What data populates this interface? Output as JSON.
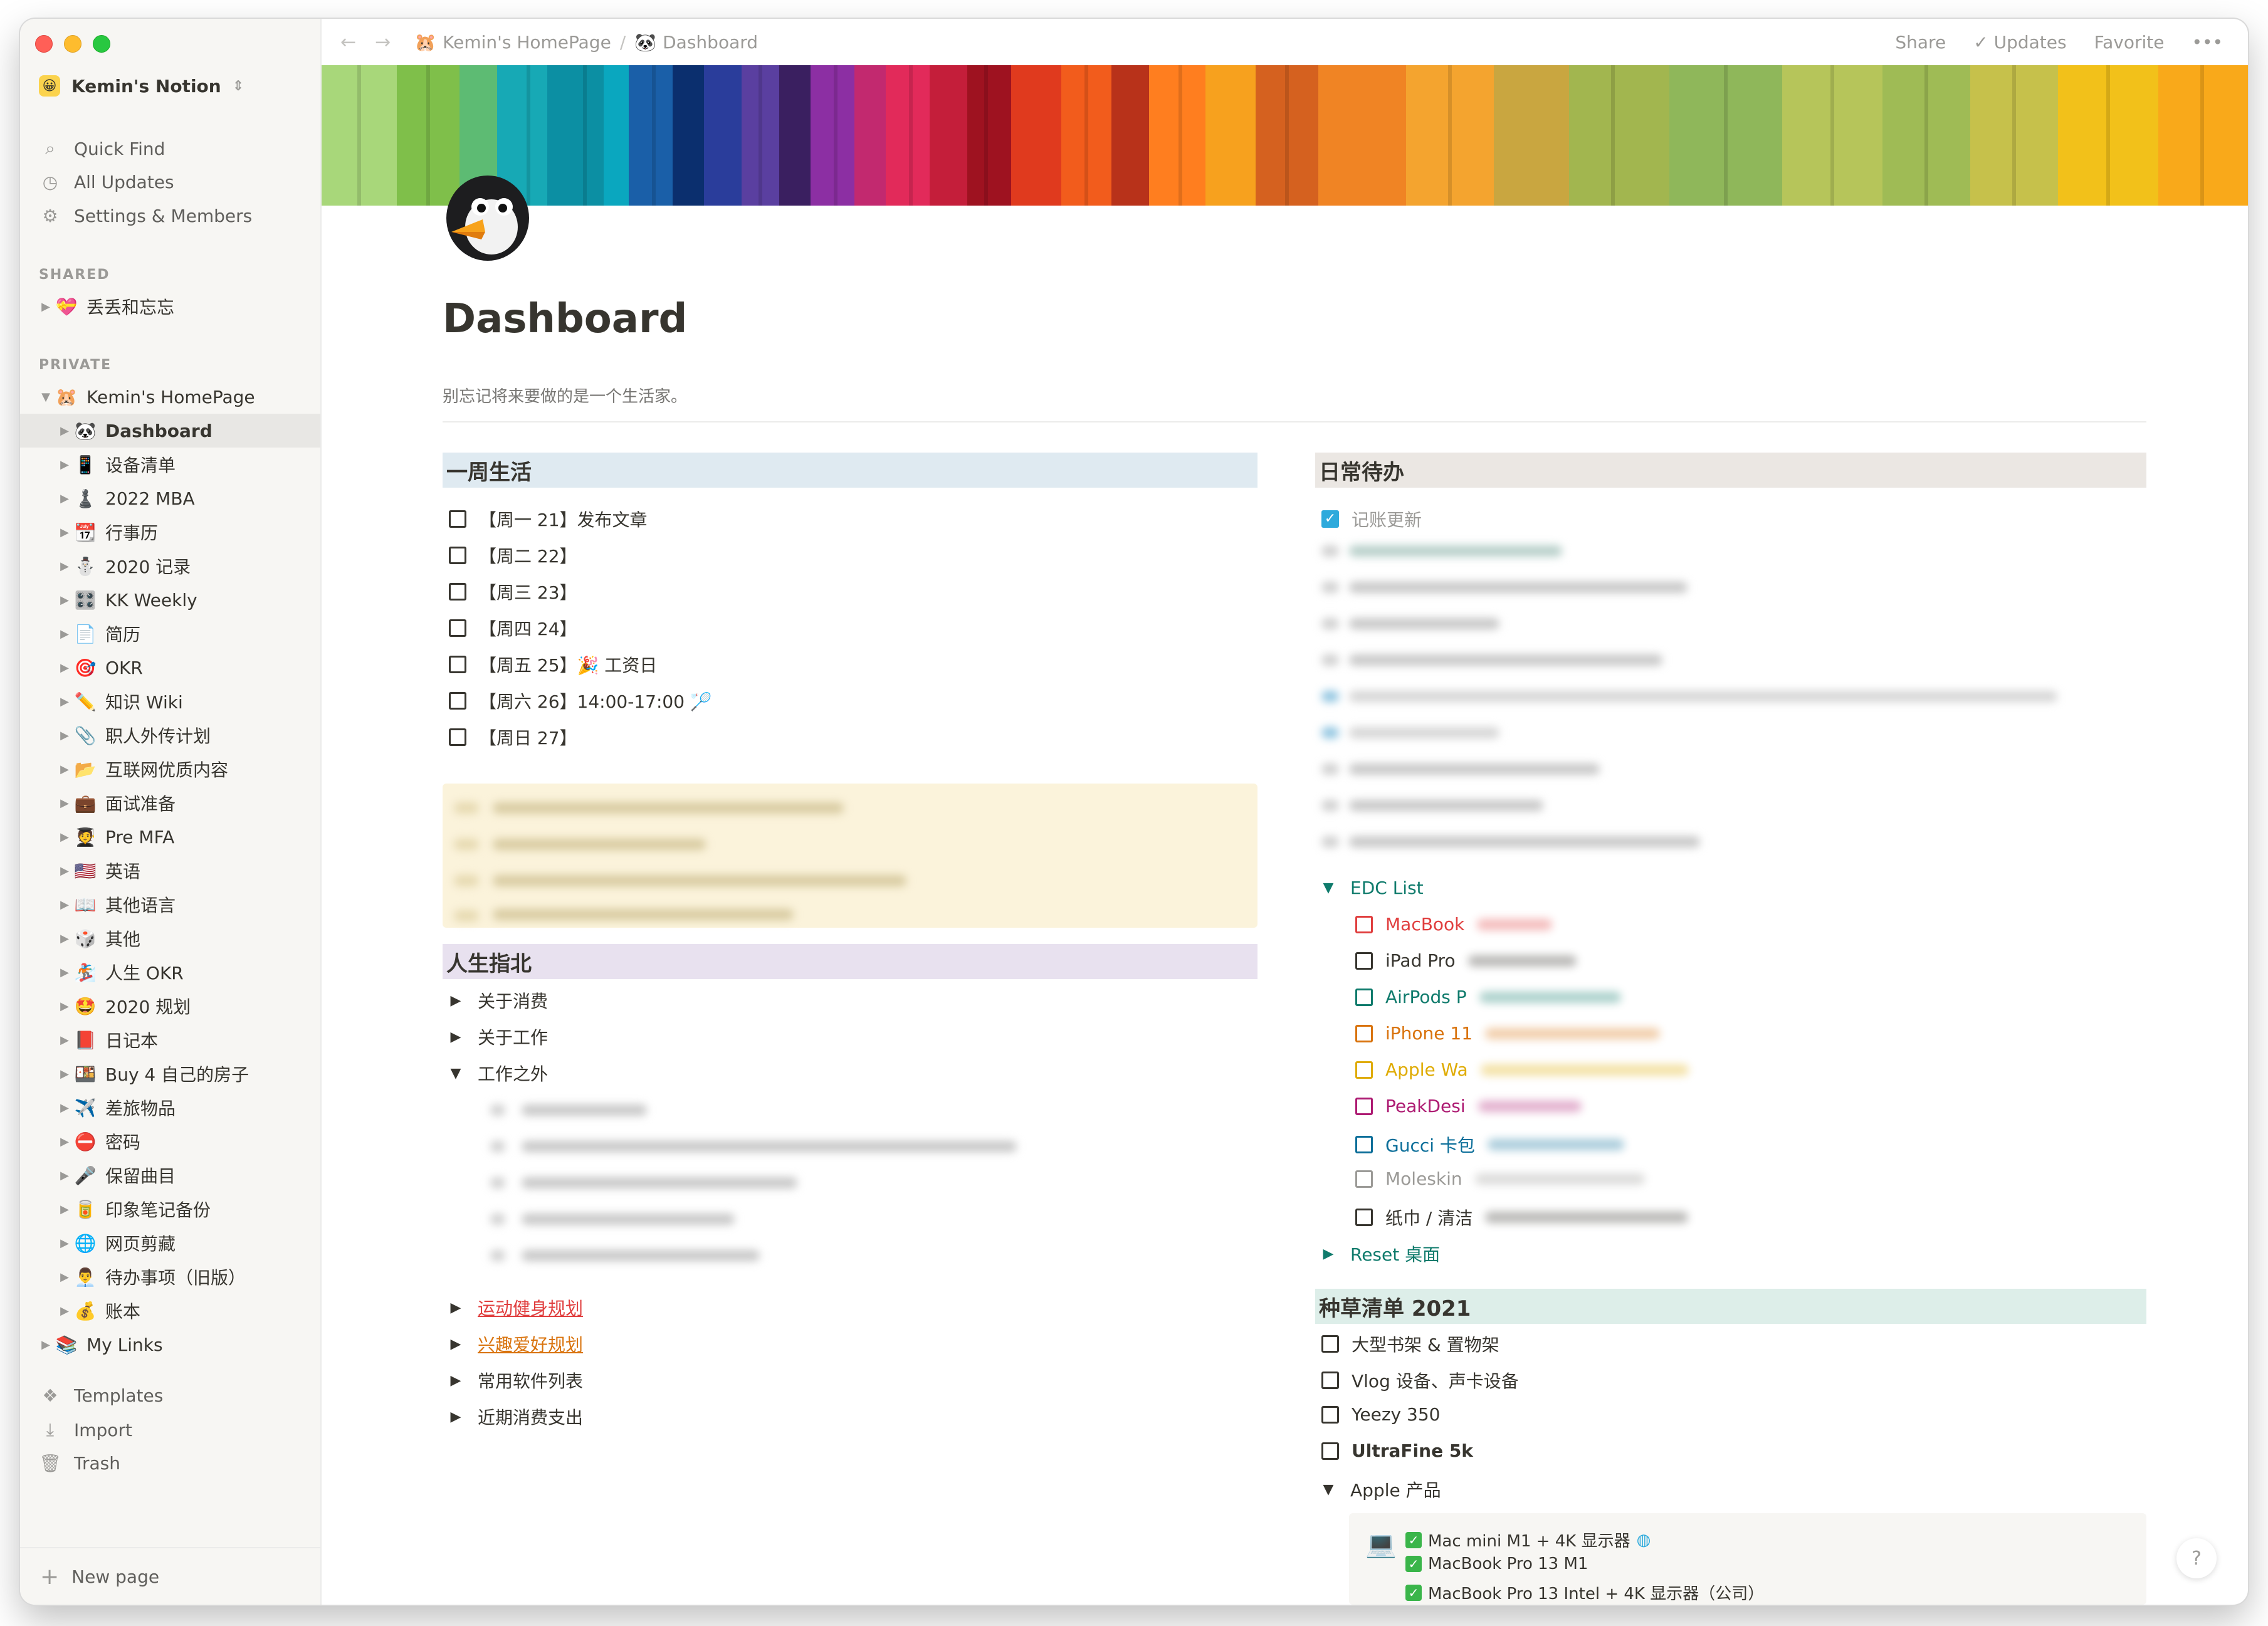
{
  "window": {
    "title": "Dashboard"
  },
  "sidebar": {
    "workspace": "Kemin's Notion",
    "workspace_icon": "😀",
    "links": [
      {
        "label": "Quick Find",
        "icon": "search-icon"
      },
      {
        "label": "All Updates",
        "icon": "clock-icon"
      },
      {
        "label": "Settings & Members",
        "icon": "gear-icon"
      }
    ],
    "shared_label": "SHARED",
    "shared_items": [
      {
        "icon": "💝",
        "label": "丢丢和忘忘"
      }
    ],
    "private_label": "PRIVATE",
    "root": {
      "icon": "🐹",
      "label": "Kemin's HomePage"
    },
    "children": [
      {
        "icon": "🐼",
        "label": "Dashboard",
        "active": true
      },
      {
        "icon": "📱",
        "label": "设备清单"
      },
      {
        "icon": "♟️",
        "label": "2022 MBA"
      },
      {
        "icon": "📆",
        "label": "行事历"
      },
      {
        "icon": "⛄",
        "label": "2020 记录"
      },
      {
        "icon": "🎛️",
        "label": "KK Weekly"
      },
      {
        "icon": "📄",
        "label": "简历"
      },
      {
        "icon": "🎯",
        "label": "OKR"
      },
      {
        "icon": "✏️",
        "label": "知识 Wiki"
      },
      {
        "icon": "📎",
        "label": "职人外传计划"
      },
      {
        "icon": "📂",
        "label": "互联网优质内容"
      },
      {
        "icon": "💼",
        "label": "面试准备"
      },
      {
        "icon": "🧑‍🎓",
        "label": "Pre MFA"
      },
      {
        "icon": "🇺🇸",
        "label": "英语"
      },
      {
        "icon": "📖",
        "label": "其他语言"
      },
      {
        "icon": "🎲",
        "label": "其他"
      },
      {
        "icon": "🏂",
        "label": "人生 OKR"
      },
      {
        "icon": "🤩",
        "label": "2020 规划"
      },
      {
        "icon": "📕",
        "label": "日记本"
      },
      {
        "icon": "🍱",
        "label": "Buy 4 自己的房子"
      },
      {
        "icon": "✈️",
        "label": "差旅物品"
      },
      {
        "icon": "⛔",
        "label": "密码"
      },
      {
        "icon": "🎤",
        "label": "保留曲目"
      },
      {
        "icon": "🥫",
        "label": "印象笔记备份"
      },
      {
        "icon": "🌐",
        "label": "网页剪藏"
      },
      {
        "icon": "👨‍💼",
        "label": "待办事项（旧版）"
      },
      {
        "icon": "💰",
        "label": "账本"
      }
    ],
    "my_links": {
      "icon": "📚",
      "label": "My Links"
    },
    "bottom_links": [
      {
        "label": "Templates",
        "icon": "templates-icon"
      },
      {
        "label": "Import",
        "icon": "import-icon"
      },
      {
        "label": "Trash",
        "icon": "trash-icon"
      }
    ],
    "new_page": "New page"
  },
  "topbar": {
    "breadcrumb": [
      {
        "icon": "🐹",
        "label": "Kemin's HomePage"
      },
      {
        "icon": "🐼",
        "label": "Dashboard"
      }
    ],
    "separator": "/",
    "actions": [
      "Share",
      "Updates",
      "Favorite",
      "•••"
    ]
  },
  "page": {
    "icon": "penguin-icon",
    "title": "Dashboard",
    "subtitle": "别忘记将来要做的是一个生活家。"
  },
  "left": {
    "week": {
      "heading": "一周生活",
      "bg": "#dfeaf1",
      "items": [
        {
          "text": "【周一 21】发布文章"
        },
        {
          "text": "【周二 22】"
        },
        {
          "text": "【周三 23】"
        },
        {
          "text": "【周四 24】"
        },
        {
          "text": "【周五 25】🎉 工资日"
        },
        {
          "text": "【周六 26】14:00-17:00 🏸"
        },
        {
          "text": "【周日 27】"
        }
      ]
    },
    "guide": {
      "heading": "人生指北",
      "bg": "#e8e1ef",
      "toggles": [
        {
          "label": "关于消费",
          "arrow": "▶"
        },
        {
          "label": "关于工作",
          "arrow": "▶"
        },
        {
          "label": "工作之外",
          "arrow": "▼"
        }
      ],
      "links": [
        {
          "label": "运动健身规划",
          "color": "#e03e3e"
        },
        {
          "label": "兴趣爱好规划",
          "color": "#d9730d"
        }
      ],
      "more": [
        {
          "label": "常用软件列表"
        },
        {
          "label": "近期消费支出"
        }
      ]
    }
  },
  "right": {
    "daily": {
      "heading": "日常待办",
      "bg": "#ebe7e3",
      "first": "记账更新",
      "edc": {
        "label": "EDC List",
        "items": [
          {
            "text": "MacBook",
            "color": "#e03e3e",
            "cls": "red"
          },
          {
            "text": "iPad Pro",
            "color": "#37352f",
            "cls": ""
          },
          {
            "text": "AirPods P",
            "color": "#0f7b6c",
            "cls": "teal"
          },
          {
            "text": "iPhone 11",
            "color": "#d9730d",
            "cls": "orange"
          },
          {
            "text": "Apple Wa",
            "color": "#dfab01",
            "cls": "yellow"
          },
          {
            "text": "PeakDesi",
            "color": "#ad1a72",
            "cls": "pink"
          },
          {
            "text": "Gucci 卡包",
            "color": "#0b6e99",
            "cls": "blue"
          },
          {
            "text": "Moleskin",
            "color": "#9b9a97",
            "cls": "grey"
          },
          {
            "text": "纸巾 / 清洁",
            "color": "#37352f",
            "cls": ""
          }
        ]
      },
      "reset": "Reset 桌面"
    },
    "grass": {
      "heading": "种草清单 2021",
      "bg": "#ddeee9",
      "items": [
        {
          "text": "大型书架 & 置物架"
        },
        {
          "text": "Vlog 设备、声卡设备"
        },
        {
          "text": "Yeezy 350"
        },
        {
          "text": "UltraFine 5k",
          "bold": true
        }
      ],
      "apple": {
        "label": "Apple 产品",
        "lines": [
          {
            "text": "Mac mini M1 + 4K 显示器"
          },
          {
            "text": "MacBook Pro 13 M1"
          },
          {
            "text": "MacBook Pro 13 Intel + 4K 显示器（公司）"
          }
        ]
      }
    }
  },
  "help": "?"
}
